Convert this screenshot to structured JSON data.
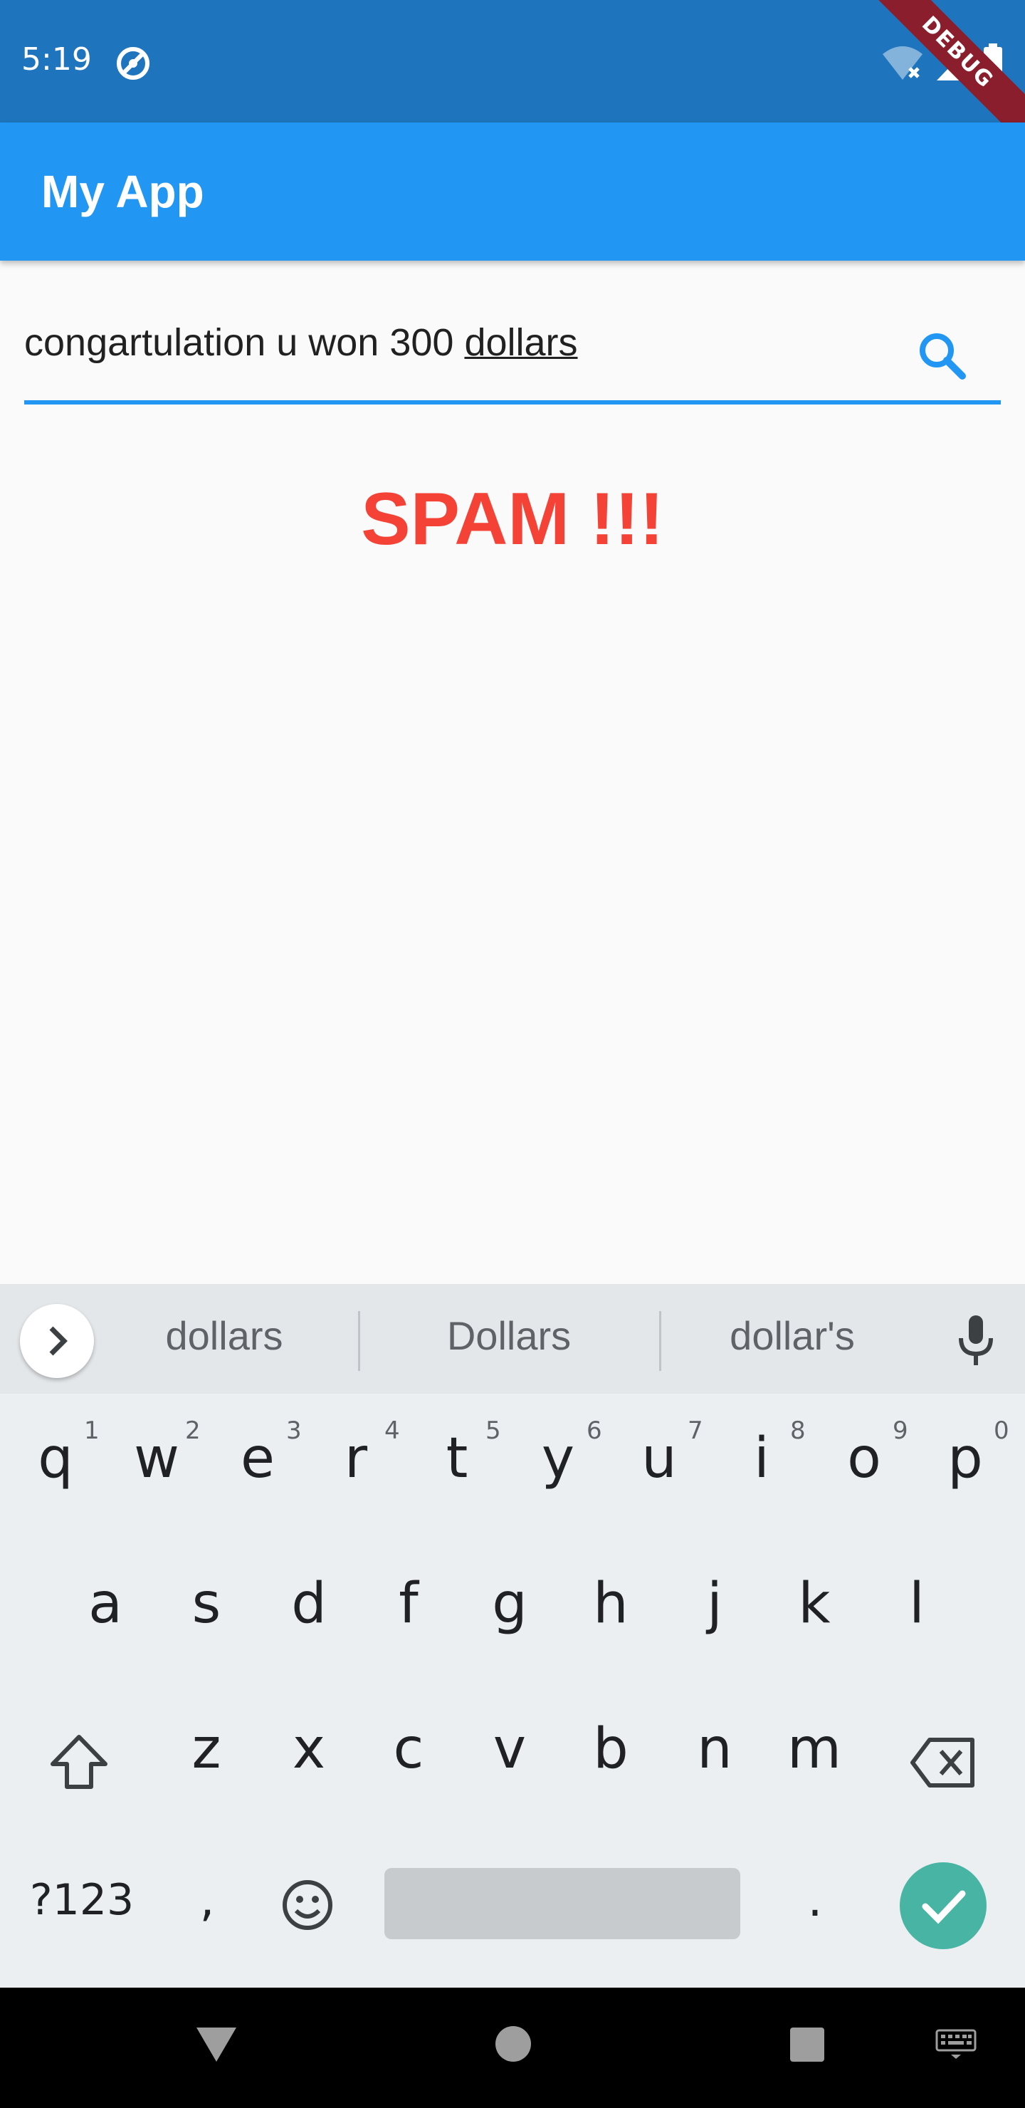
{
  "status_bar": {
    "time": "5:19",
    "debug_label": "DEBUG"
  },
  "app_bar": {
    "title": "My App"
  },
  "search": {
    "value_plain": "congartulation u won 300 ",
    "value_underlined": "dollars",
    "search_icon": "search-icon"
  },
  "result": {
    "text": "SPAM !!!",
    "color": "#f44336"
  },
  "keyboard": {
    "suggestions": [
      "dollars",
      "Dollars",
      "dollar's"
    ],
    "row1": [
      "q",
      "w",
      "e",
      "r",
      "t",
      "y",
      "u",
      "i",
      "o",
      "p"
    ],
    "row1_hints": [
      "1",
      "2",
      "3",
      "4",
      "5",
      "6",
      "7",
      "8",
      "9",
      "0"
    ],
    "row2": [
      "a",
      "s",
      "d",
      "f",
      "g",
      "h",
      "j",
      "k",
      "l"
    ],
    "row3": [
      "z",
      "x",
      "c",
      "v",
      "b",
      "n",
      "m"
    ],
    "symbols_label": "?123",
    "comma": ",",
    "period": "."
  },
  "colors": {
    "status_bar": "#1e75bd",
    "app_bar": "#2196f3",
    "accent": "#2196f3",
    "enter_key": "#48b4a4"
  }
}
